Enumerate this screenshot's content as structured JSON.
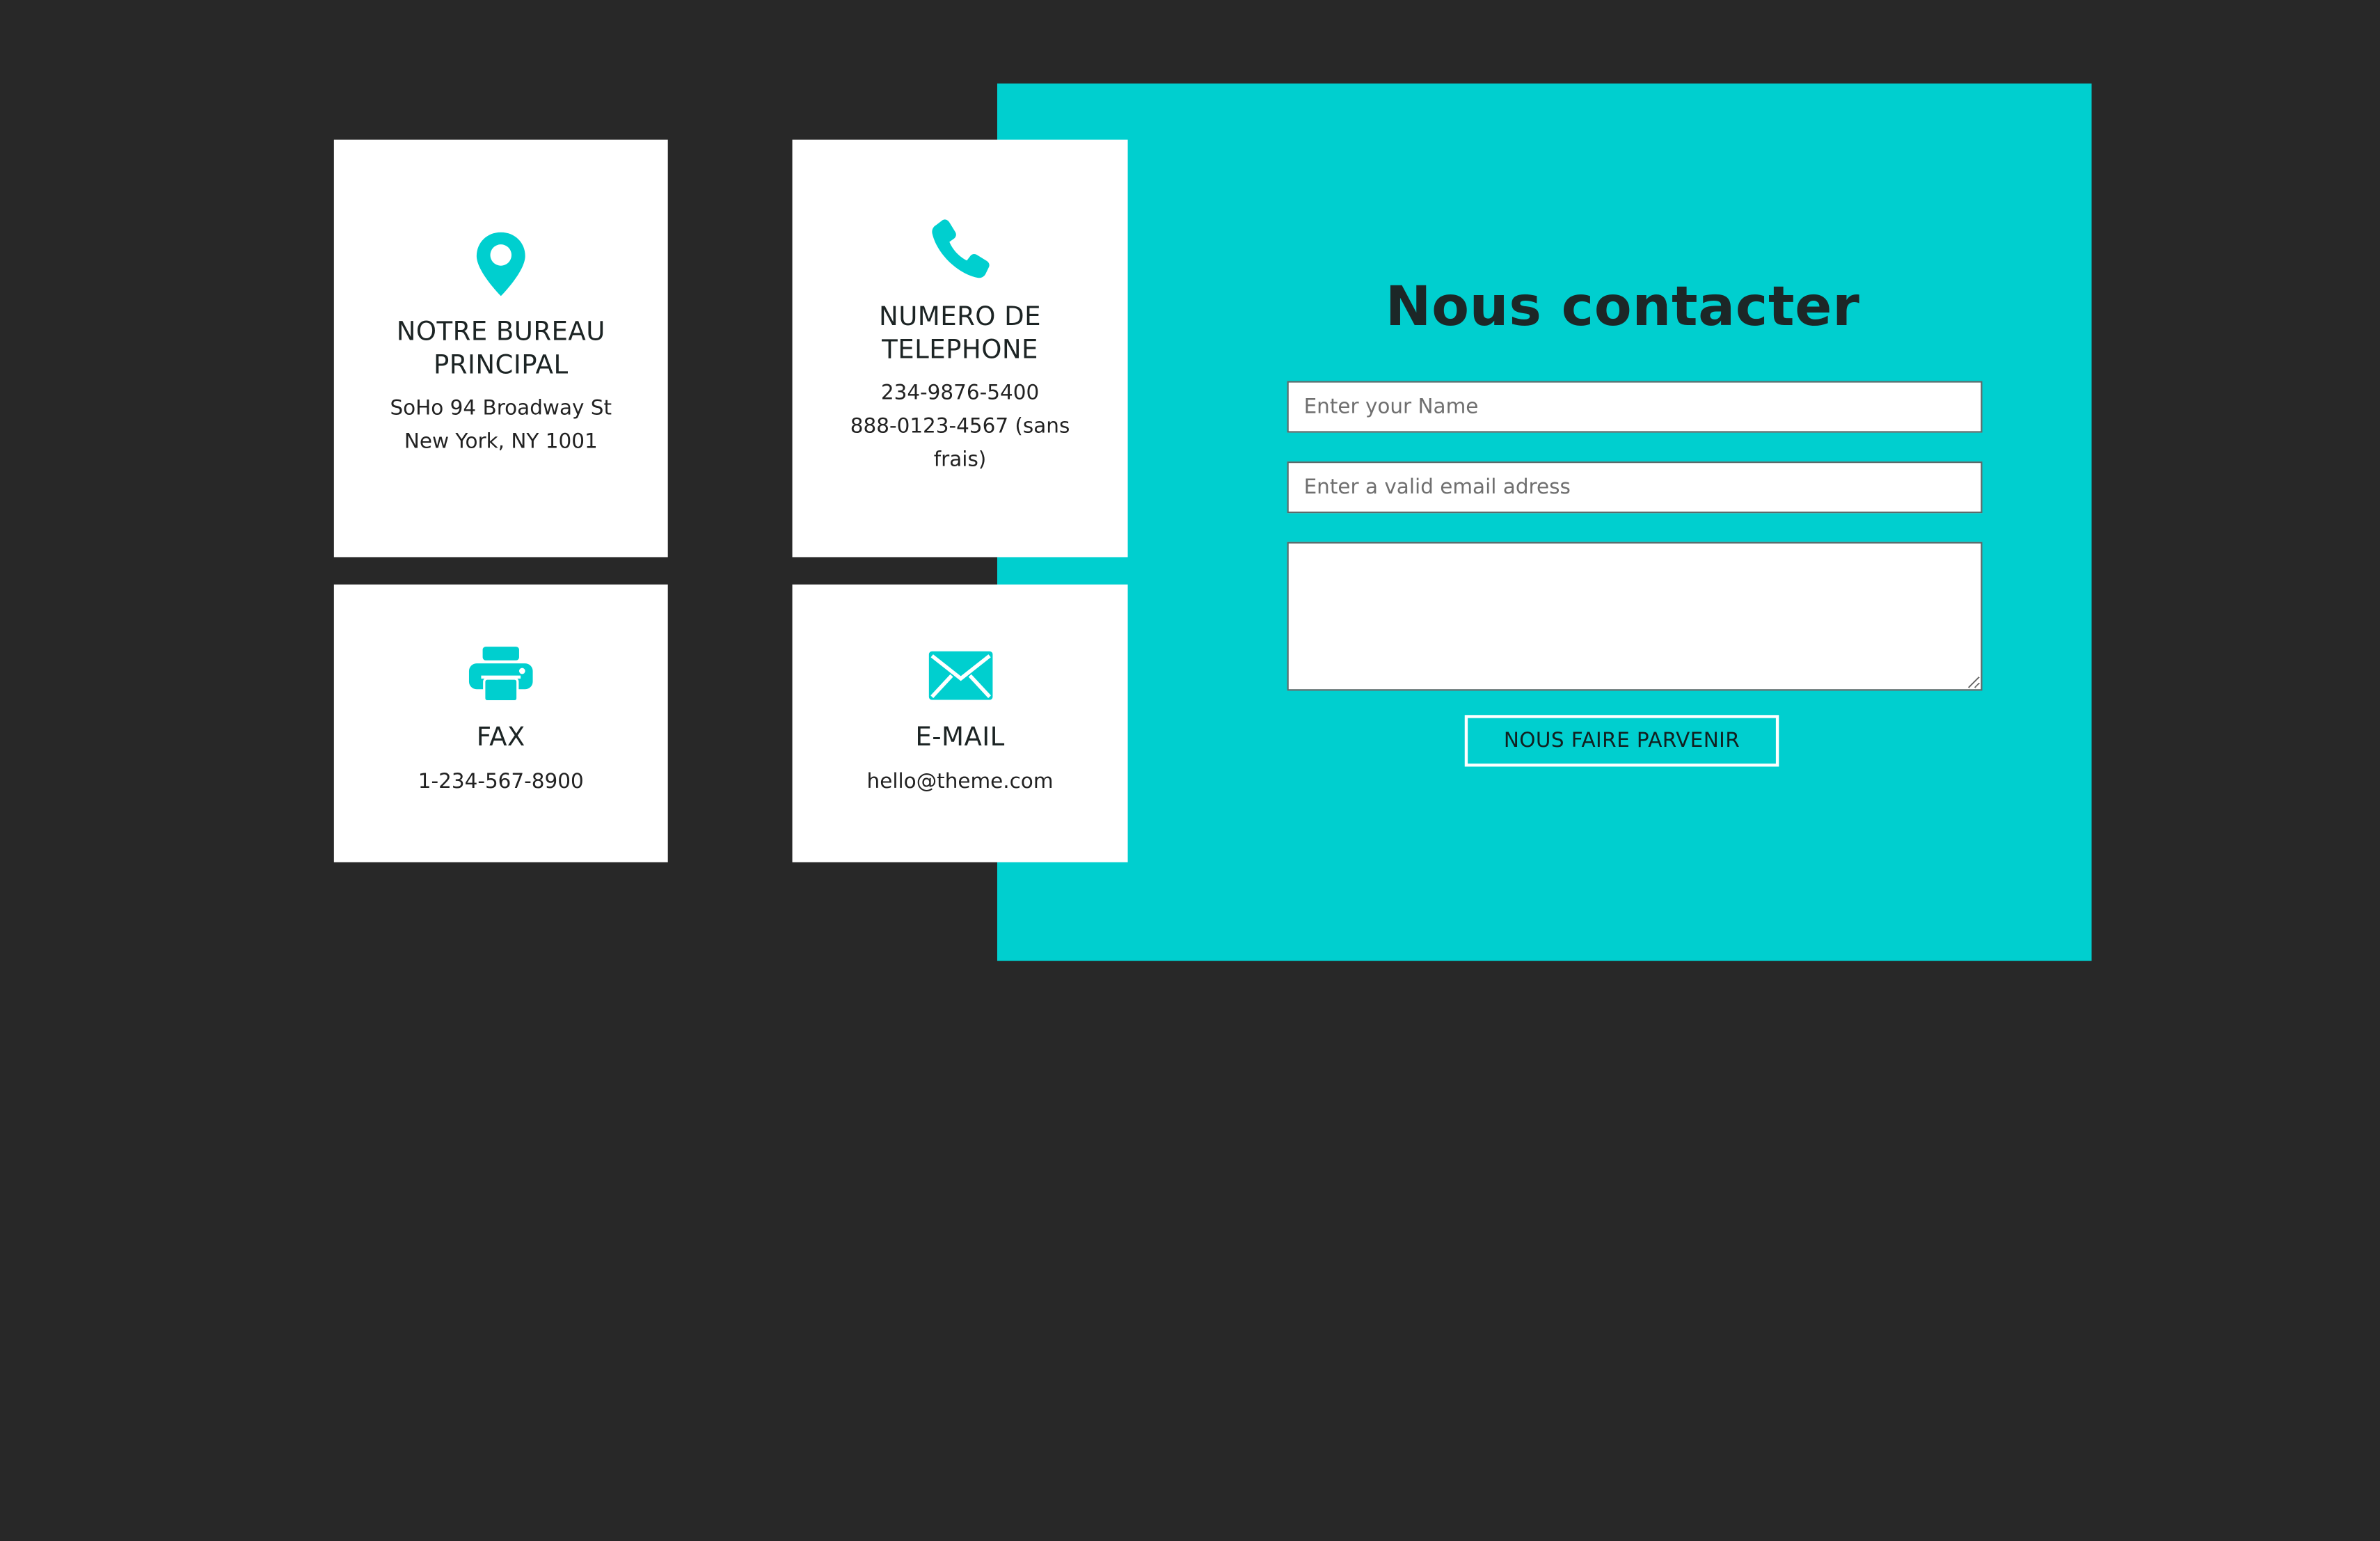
{
  "colors": {
    "background": "#282828",
    "accent": "#00cfcf",
    "card": "#ffffff",
    "text": "#1c2424"
  },
  "cards": {
    "office": {
      "icon": "map-pin-icon",
      "title_line1": "NOTRE BUREAU",
      "title_line2": "PRINCIPAL",
      "line1": "SoHo 94 Broadway St",
      "line2": "New York, NY 1001"
    },
    "phone": {
      "icon": "phone-icon",
      "title_line1": "NUMERO DE",
      "title_line2": "TELEPHONE",
      "line1": "234-9876-5400",
      "line2": "888-0123-4567 (sans",
      "line3": "frais)"
    },
    "fax": {
      "icon": "printer-icon",
      "title": "FAX",
      "line1": "1-234-567-8900"
    },
    "email": {
      "icon": "envelope-icon",
      "title": "E-MAIL",
      "line1": "hello@theme.com"
    }
  },
  "form": {
    "title": "Nous contacter",
    "name_placeholder": "Enter your Name",
    "email_placeholder": "Enter a valid email adress",
    "message_placeholder": "",
    "submit_label": "NOUS FAIRE PARVENIR"
  }
}
